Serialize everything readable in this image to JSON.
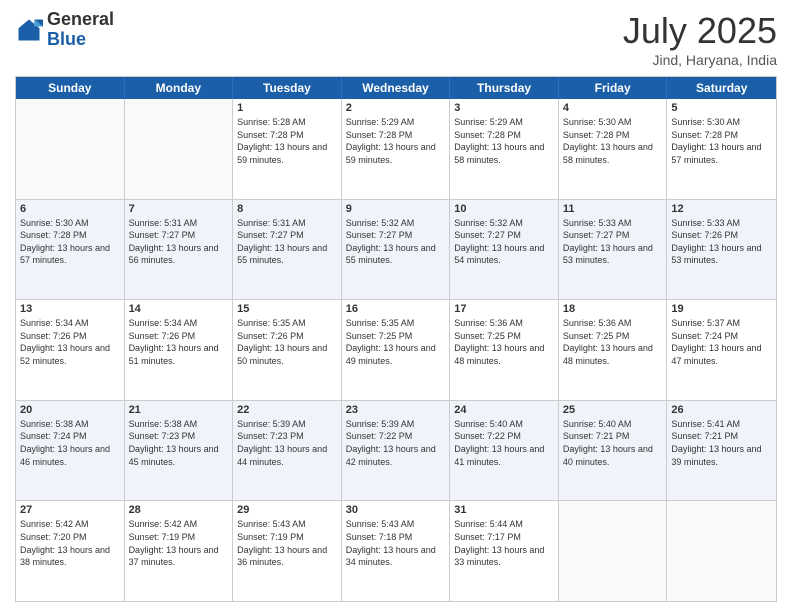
{
  "header": {
    "logo_general": "General",
    "logo_blue": "Blue",
    "month_title": "July 2025",
    "location": "Jind, Haryana, India"
  },
  "weekdays": [
    "Sunday",
    "Monday",
    "Tuesday",
    "Wednesday",
    "Thursday",
    "Friday",
    "Saturday"
  ],
  "weeks": [
    [
      {
        "day": "",
        "info": ""
      },
      {
        "day": "",
        "info": ""
      },
      {
        "day": "1",
        "info": "Sunrise: 5:28 AM\nSunset: 7:28 PM\nDaylight: 13 hours and 59 minutes."
      },
      {
        "day": "2",
        "info": "Sunrise: 5:29 AM\nSunset: 7:28 PM\nDaylight: 13 hours and 59 minutes."
      },
      {
        "day": "3",
        "info": "Sunrise: 5:29 AM\nSunset: 7:28 PM\nDaylight: 13 hours and 58 minutes."
      },
      {
        "day": "4",
        "info": "Sunrise: 5:30 AM\nSunset: 7:28 PM\nDaylight: 13 hours and 58 minutes."
      },
      {
        "day": "5",
        "info": "Sunrise: 5:30 AM\nSunset: 7:28 PM\nDaylight: 13 hours and 57 minutes."
      }
    ],
    [
      {
        "day": "6",
        "info": "Sunrise: 5:30 AM\nSunset: 7:28 PM\nDaylight: 13 hours and 57 minutes."
      },
      {
        "day": "7",
        "info": "Sunrise: 5:31 AM\nSunset: 7:27 PM\nDaylight: 13 hours and 56 minutes."
      },
      {
        "day": "8",
        "info": "Sunrise: 5:31 AM\nSunset: 7:27 PM\nDaylight: 13 hours and 55 minutes."
      },
      {
        "day": "9",
        "info": "Sunrise: 5:32 AM\nSunset: 7:27 PM\nDaylight: 13 hours and 55 minutes."
      },
      {
        "day": "10",
        "info": "Sunrise: 5:32 AM\nSunset: 7:27 PM\nDaylight: 13 hours and 54 minutes."
      },
      {
        "day": "11",
        "info": "Sunrise: 5:33 AM\nSunset: 7:27 PM\nDaylight: 13 hours and 53 minutes."
      },
      {
        "day": "12",
        "info": "Sunrise: 5:33 AM\nSunset: 7:26 PM\nDaylight: 13 hours and 53 minutes."
      }
    ],
    [
      {
        "day": "13",
        "info": "Sunrise: 5:34 AM\nSunset: 7:26 PM\nDaylight: 13 hours and 52 minutes."
      },
      {
        "day": "14",
        "info": "Sunrise: 5:34 AM\nSunset: 7:26 PM\nDaylight: 13 hours and 51 minutes."
      },
      {
        "day": "15",
        "info": "Sunrise: 5:35 AM\nSunset: 7:26 PM\nDaylight: 13 hours and 50 minutes."
      },
      {
        "day": "16",
        "info": "Sunrise: 5:35 AM\nSunset: 7:25 PM\nDaylight: 13 hours and 49 minutes."
      },
      {
        "day": "17",
        "info": "Sunrise: 5:36 AM\nSunset: 7:25 PM\nDaylight: 13 hours and 48 minutes."
      },
      {
        "day": "18",
        "info": "Sunrise: 5:36 AM\nSunset: 7:25 PM\nDaylight: 13 hours and 48 minutes."
      },
      {
        "day": "19",
        "info": "Sunrise: 5:37 AM\nSunset: 7:24 PM\nDaylight: 13 hours and 47 minutes."
      }
    ],
    [
      {
        "day": "20",
        "info": "Sunrise: 5:38 AM\nSunset: 7:24 PM\nDaylight: 13 hours and 46 minutes."
      },
      {
        "day": "21",
        "info": "Sunrise: 5:38 AM\nSunset: 7:23 PM\nDaylight: 13 hours and 45 minutes."
      },
      {
        "day": "22",
        "info": "Sunrise: 5:39 AM\nSunset: 7:23 PM\nDaylight: 13 hours and 44 minutes."
      },
      {
        "day": "23",
        "info": "Sunrise: 5:39 AM\nSunset: 7:22 PM\nDaylight: 13 hours and 42 minutes."
      },
      {
        "day": "24",
        "info": "Sunrise: 5:40 AM\nSunset: 7:22 PM\nDaylight: 13 hours and 41 minutes."
      },
      {
        "day": "25",
        "info": "Sunrise: 5:40 AM\nSunset: 7:21 PM\nDaylight: 13 hours and 40 minutes."
      },
      {
        "day": "26",
        "info": "Sunrise: 5:41 AM\nSunset: 7:21 PM\nDaylight: 13 hours and 39 minutes."
      }
    ],
    [
      {
        "day": "27",
        "info": "Sunrise: 5:42 AM\nSunset: 7:20 PM\nDaylight: 13 hours and 38 minutes."
      },
      {
        "day": "28",
        "info": "Sunrise: 5:42 AM\nSunset: 7:19 PM\nDaylight: 13 hours and 37 minutes."
      },
      {
        "day": "29",
        "info": "Sunrise: 5:43 AM\nSunset: 7:19 PM\nDaylight: 13 hours and 36 minutes."
      },
      {
        "day": "30",
        "info": "Sunrise: 5:43 AM\nSunset: 7:18 PM\nDaylight: 13 hours and 34 minutes."
      },
      {
        "day": "31",
        "info": "Sunrise: 5:44 AM\nSunset: 7:17 PM\nDaylight: 13 hours and 33 minutes."
      },
      {
        "day": "",
        "info": ""
      },
      {
        "day": "",
        "info": ""
      }
    ]
  ]
}
